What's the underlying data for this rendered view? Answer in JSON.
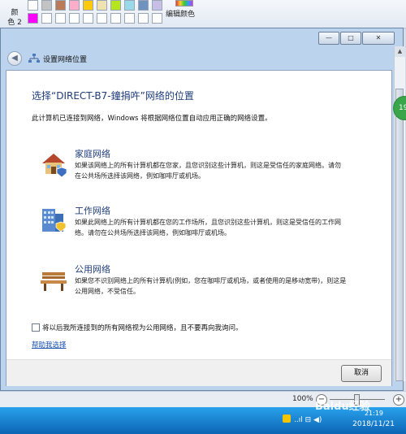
{
  "paint": {
    "color2_label": "颜\n色 2",
    "edit_colors_label": "编辑颜色",
    "swatches_row1": [
      "#ffffff",
      "#c3c3c3",
      "#b97a57",
      "#ffaec9",
      "#ffc90e",
      "#efe4b0",
      "#b5e61d",
      "#99d9ea",
      "#7092be",
      "#c8bfe7"
    ],
    "swatches_row2": [
      "#ff00ff",
      "#ffffff",
      "#ffffff",
      "#ffffff",
      "#ffffff",
      "#ffffff",
      "#ffffff",
      "#ffffff",
      "#ffffff",
      "#ffffff"
    ]
  },
  "window": {
    "title": "设置网络位置",
    "controls": {
      "minimize": "—",
      "maximize": "□",
      "close": "✕"
    }
  },
  "dialog": {
    "heading": "选择“DIRECT-B7-鐘捐吘”网络的位置",
    "intro": "此计算机已连接到网络，Windows 将根据网络位置自动应用正确的网络设置。",
    "options": [
      {
        "icon": "home-network-icon",
        "title": "家庭网络",
        "desc": "如果该网络上的所有计算机都在您家，且您识别这些计算机，则这是受信任的家庭网络。请勿在公共场所选择该网络，例如咖啡厅或机场。"
      },
      {
        "icon": "work-network-icon",
        "title": "工作网络",
        "desc": "如果此网络上的所有计算机都在您的工作场所，且您识别这些计算机，则这是受信任的工作网络。请勿在公共场所选择该网络，例如咖啡厅或机场。"
      },
      {
        "icon": "bench-icon",
        "title": "公用网络",
        "desc": "如果您不识别网络上的所有计算机(例如，您在咖啡厅或机场，或者使用的是移动宽带)，则这是公用网络，不受信任。"
      }
    ],
    "checkbox_label": "将以后我所连接到的所有网络视为公用网络，且不要再向我询问。",
    "help_link": "帮助我选择",
    "cancel": "取消"
  },
  "badge": "19",
  "status": {
    "zoom": "100%",
    "zoom_out": "−",
    "zoom_in": "+"
  },
  "taskbar": {
    "time": "21:19",
    "date": "2018/11/21",
    "tray": "..ıl ⊟ ◀)"
  },
  "watermark": "Baidu经验"
}
